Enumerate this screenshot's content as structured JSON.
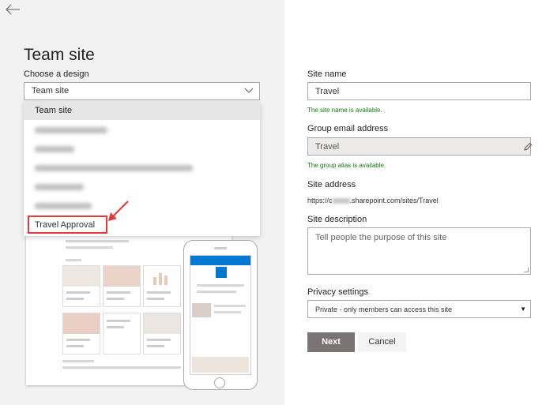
{
  "header": {
    "title": "Team site",
    "design_label": "Choose a design"
  },
  "design_select": {
    "value": "Team site",
    "options": [
      "Team site",
      "",
      "",
      "",
      "",
      "",
      "Travel Approval"
    ],
    "highlighted": "Travel Approval"
  },
  "form": {
    "site_name_label": "Site name",
    "site_name_value": "Travel",
    "site_name_status": "The site name is available.",
    "group_email_label": "Group email address",
    "group_email_value": "Travel",
    "group_alias_status": "The group alias is available.",
    "site_address_label": "Site address",
    "site_address_prefix": "https://c",
    "site_address_suffix": ".sharepoint.com/sites/Travel",
    "site_description_label": "Site description",
    "site_description_placeholder": "Tell people the purpose of this site",
    "privacy_label": "Privacy settings",
    "privacy_value": "Private - only members can access this site"
  },
  "buttons": {
    "next": "Next",
    "cancel": "Cancel"
  },
  "colors": {
    "status_green": "#107c10",
    "highlight_red": "#e53935",
    "next_bg": "#7a7574"
  },
  "icons": {
    "back": "arrow-left-icon",
    "dropdown": "chevron-down-icon",
    "edit": "pencil-icon",
    "caret": "caret-down-icon"
  }
}
